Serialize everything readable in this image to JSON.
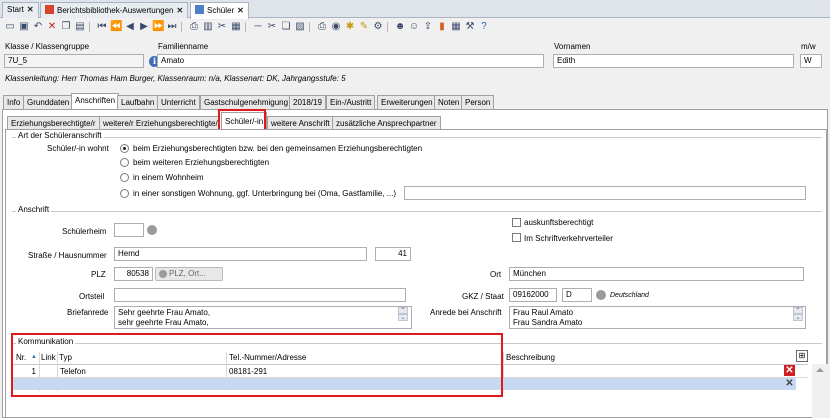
{
  "window_tabs": [
    {
      "label": "Start"
    },
    {
      "label": "Berichtsbibliothek-Auswertungen"
    },
    {
      "label": "Schüler"
    }
  ],
  "header": {
    "klasse_label": "Klasse / Klassengruppe",
    "klasse_value": "7U_5",
    "familienname_label": "Familienname",
    "familienname_value": "Amato",
    "vornamen_label": "Vornamen",
    "vornamen_value": "Edith",
    "mw_label": "m/w",
    "mw_value": "W",
    "klassenleitung": "Klassenleitung: Herr Thomas Ham Burger, Klassenraum: n/a, Klassenart: DK, Jahrgangsstufe: 5"
  },
  "main_tabs": [
    "Info",
    "Grunddaten",
    "Anschriften",
    "Laufbahn",
    "Unterricht",
    "Gastschulgenehmigung",
    "2018/19",
    "Ein-/Austritt",
    "Erweiterungen",
    "Noten",
    "Person"
  ],
  "sub_tabs": [
    "Erziehungsberechtigte/r",
    "weitere/r Erziehungsberechtigte/r",
    "Schüler/-in",
    "weitere Anschrift",
    "zusätzliche Ansprechpartner"
  ],
  "schueleranschrift": {
    "group_title": "Art der Schüleranschrift",
    "wohnt_label": "Schüler/-in wohnt",
    "options": [
      "beim Erziehungsberechtigten bzw. bei den gemeinsamen Erziehungsberechtigten",
      "beim weiteren Erziehungsberechtigten",
      "in einem Wohnheim",
      "in einer sonstigen Wohnung, ggf. Unterbringung bei (Oma, Gastfamilie, ...)"
    ],
    "selected_index": 0
  },
  "anschrift": {
    "group_title": "Anschrift",
    "schuelerheim_label": "Schülerheim",
    "auskunft_label": "auskunftsberechtigt",
    "schriftverkehr_label": "Im Schriftverkehrverteiler",
    "strasse_label": "Straße / Hausnummer",
    "strasse_value": "Hemd",
    "hausnummer_value": "41",
    "plz_label": "PLZ",
    "plz_value": "80538",
    "plz_button": "PLZ, Ort...",
    "ort_label": "Ort",
    "ort_value": "München",
    "ortsteil_label": "Ortsteil",
    "gkz_label": "GKZ / Staat",
    "gkz_value": "09162000",
    "staat_value": "D",
    "staat_name": "Deutschland",
    "briefanrede_label": "Briefanrede",
    "briefanrede_lines": [
      "Sehr geehrte Frau Amato,",
      "sehr geehrte Frau Amato,"
    ],
    "anrede_label": "Anrede bei Anschrift",
    "anrede_lines": [
      "Frau Raul Amato",
      "Frau Sandra Amato"
    ]
  },
  "kommunikation": {
    "group_title": "Kommunikation",
    "columns": [
      "Nr.",
      "Link",
      "Typ",
      "Tel.-Nummer/Adresse",
      "Beschreibung"
    ],
    "rows": [
      {
        "nr": "1",
        "link": "",
        "typ": "Telefon",
        "nummer": "08181-291",
        "beschreibung": ""
      }
    ]
  },
  "colors": {
    "highlight": "#e01a1a",
    "selection": "#c7d8f3",
    "accent": "#3d6fb6"
  }
}
